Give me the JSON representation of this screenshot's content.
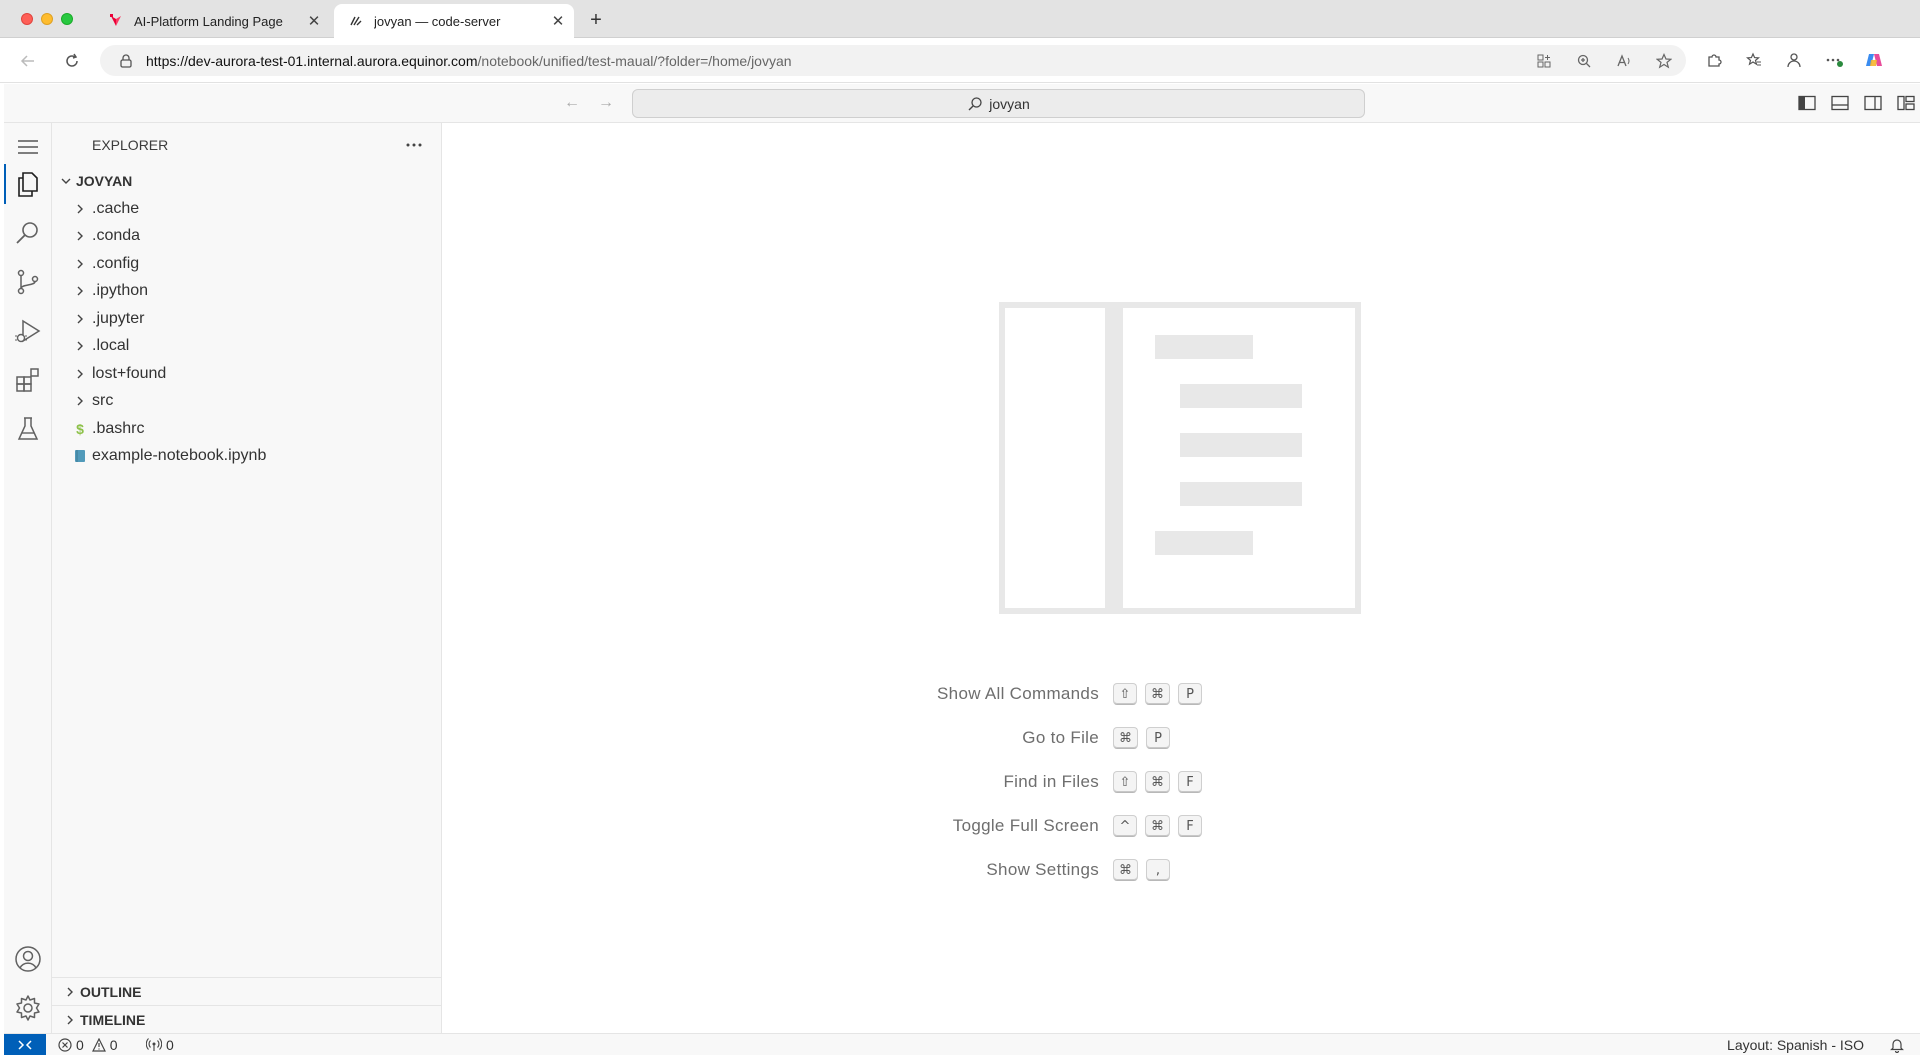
{
  "browser": {
    "tabs": [
      {
        "label": "AI-Platform Landing Page",
        "active": false
      },
      {
        "label": "jovyan — code-server",
        "active": true
      }
    ],
    "url_host": "https://dev-aurora-test-01.internal.aurora.equinor.com",
    "url_path": "/notebook/unified/test-maual/?folder=/home/jovyan"
  },
  "titlebar": {
    "command_center": "jovyan"
  },
  "explorer": {
    "title": "EXPLORER",
    "root": "JOVYAN",
    "items": [
      {
        "label": ".cache",
        "type": "folder"
      },
      {
        "label": ".conda",
        "type": "folder"
      },
      {
        "label": ".config",
        "type": "folder"
      },
      {
        "label": ".ipython",
        "type": "folder"
      },
      {
        "label": ".jupyter",
        "type": "folder"
      },
      {
        "label": ".local",
        "type": "folder"
      },
      {
        "label": "lost+found",
        "type": "folder"
      },
      {
        "label": "src",
        "type": "folder"
      },
      {
        "label": ".bashrc",
        "type": "shell-file"
      },
      {
        "label": "example-notebook.ipynb",
        "type": "notebook-file"
      }
    ],
    "outline": "OUTLINE",
    "timeline": "TIMELINE"
  },
  "shortcuts": [
    {
      "label": "Show All Commands",
      "keys": [
        "⇧",
        "⌘",
        "P"
      ]
    },
    {
      "label": "Go to File",
      "keys": [
        "⌘",
        "P"
      ]
    },
    {
      "label": "Find in Files",
      "keys": [
        "⇧",
        "⌘",
        "F"
      ]
    },
    {
      "label": "Toggle Full Screen",
      "keys": [
        "^",
        "⌘",
        "F"
      ]
    },
    {
      "label": "Show Settings",
      "keys": [
        "⌘",
        ","
      ]
    }
  ],
  "statusbar": {
    "errors": "0",
    "warnings": "0",
    "ports": "0",
    "layout": "Layout: Spanish - ISO"
  },
  "colors": {
    "accent": "#005fb8",
    "bash_icon": "#8dc149",
    "notebook_icon": "#519aba"
  }
}
